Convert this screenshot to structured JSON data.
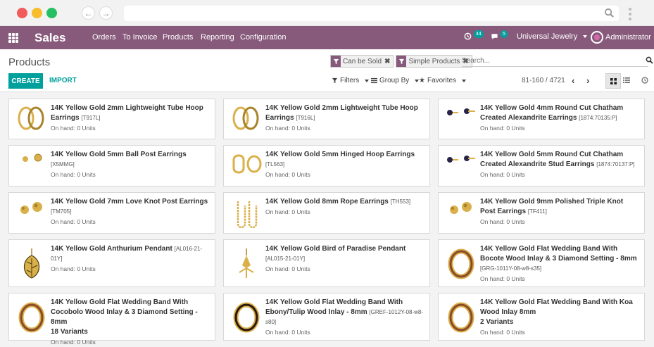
{
  "app": {
    "name": "Sales",
    "menus": [
      "Orders",
      "To Invoice",
      "Products",
      "Reporting",
      "Configuration"
    ],
    "activity_count": "44",
    "message_count": "5",
    "company": "Universal Jewelry",
    "user": "Administrator",
    "accent": "#875a7b",
    "primary": "#00a09d"
  },
  "control_panel": {
    "breadcrumb": "Products",
    "facets": [
      "Can be Sold",
      "Simple Products"
    ],
    "search_placeholder": "Search...",
    "create_label": "CREATE",
    "import_label": "IMPORT",
    "filters_label": "Filters",
    "groupby_label": "Group By",
    "favorites_label": "Favorites",
    "pager": "81-160 / 4721"
  },
  "products": [
    {
      "name": "14K Yellow Gold 2mm Lightweight Tube Hoop Earrings",
      "code": "[T917L]",
      "onhand": "On hand: 0 Units",
      "thumb": "hoop"
    },
    {
      "name": "14K Yellow Gold 2mm Lightweight Tube Hoop Earrings",
      "code": "[T916L]",
      "onhand": "On hand: 0 Units",
      "thumb": "hoop"
    },
    {
      "name": "14K Yellow Gold 4mm Round Cut Chatham Created Alexandrite Earrings",
      "code": "[1874:70135:P]",
      "onhand": "On hand: 0 Units",
      "thumb": "stud-dark"
    },
    {
      "name": "14K Yellow Gold 5mm Ball Post Earrings",
      "code": "[X5MMG]",
      "onhand": "On hand: 0 Units",
      "thumb": "ball"
    },
    {
      "name": "14K Yellow Gold 5mm Hinged Hoop Earrings",
      "code": "[TL563]",
      "onhand": "On hand: 0 Units",
      "thumb": "hinged"
    },
    {
      "name": "14K Yellow Gold 5mm Round Cut Chatham Created Alexandrite Stud Earrings",
      "code": "[1874:70137:P]",
      "onhand": "On hand: 0 Units",
      "thumb": "stud-dark"
    },
    {
      "name": "14K Yellow Gold 7mm Love Knot Post Earrings",
      "code": "[TM705]",
      "onhand": "On hand: 0 Units",
      "thumb": "knot"
    },
    {
      "name": "14K Yellow Gold 8mm Rope Earrings",
      "code": "[TH553]",
      "onhand": "On hand: 0 Units",
      "thumb": "rope"
    },
    {
      "name": "14K Yellow Gold 9mm Polished Triple Knot Post Earrings",
      "code": "[TF411]",
      "onhand": "On hand: 0 Units",
      "thumb": "knot"
    },
    {
      "name": "14K Yellow Gold Anthurium Pendant",
      "code": "[AL016-21-01Y]",
      "onhand": "On hand: 0 Units",
      "thumb": "leaf"
    },
    {
      "name": "14K Yellow Gold Bird of Paradise Pendant",
      "code": "[AL015-21-01Y]",
      "onhand": "On hand: 0 Units",
      "thumb": "bird"
    },
    {
      "name": "14K Yellow Gold Flat Wedding Band With Bocote Wood Inlay & 3 Diamond Setting - 8mm",
      "code": "[GRG-1011Y-08-w8-s35]",
      "onhand": "On hand: 0 Units",
      "thumb": "ring"
    },
    {
      "name": "14K Yellow Gold Flat Wedding Band With Cocobolo Wood Inlay & 3 Diamond Setting - 8mm",
      "code": "",
      "variants": "18 Variants",
      "onhand": "On hand: 0 Units",
      "thumb": "ring"
    },
    {
      "name": "14K Yellow Gold Flat Wedding Band With Ebony/Tulip Wood Inlay - 8mm",
      "code": "[GREF-1012Y-08-w8-s80]",
      "onhand": "On hand: 0 Units",
      "thumb": "ring-dark"
    },
    {
      "name": "14K Yellow Gold Flat Wedding Band With Koa Wood Inlay 8mm",
      "code": "",
      "variants": "2 Variants",
      "onhand": "On hand: 0 Units",
      "thumb": "ring"
    }
  ]
}
